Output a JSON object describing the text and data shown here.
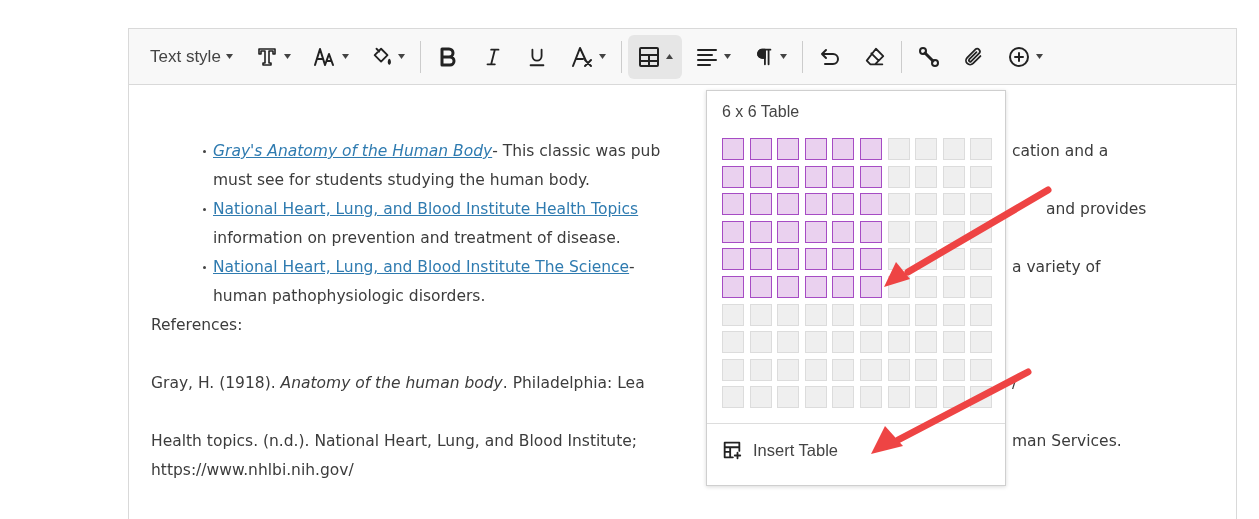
{
  "toolbar": [
    {
      "kind": "label",
      "text": "Text style",
      "caret": true,
      "selected": false
    },
    {
      "kind": "font-icon",
      "caret": true,
      "selected": false
    },
    {
      "kind": "size-icon",
      "caret": true,
      "selected": false
    },
    {
      "kind": "fill-icon",
      "caret": true,
      "selected": false
    },
    {
      "kind": "separator"
    },
    {
      "kind": "bold-icon",
      "caret": false,
      "selected": false
    },
    {
      "kind": "italic-icon",
      "caret": false,
      "selected": false
    },
    {
      "kind": "underline-icon",
      "caret": false,
      "selected": false
    },
    {
      "kind": "clear-format-icon",
      "caret": true,
      "selected": false
    },
    {
      "kind": "separator"
    },
    {
      "kind": "table-icon",
      "caret": true,
      "selected": true
    },
    {
      "kind": "align-icon",
      "caret": true,
      "selected": false
    },
    {
      "kind": "paragraph-icon",
      "caret": true,
      "selected": false
    },
    {
      "kind": "separator"
    },
    {
      "kind": "undo-icon",
      "caret": false,
      "selected": false
    },
    {
      "kind": "eraser-icon",
      "caret": false,
      "selected": false
    },
    {
      "kind": "separator"
    },
    {
      "kind": "link-icon",
      "caret": false,
      "selected": false
    },
    {
      "kind": "attach-icon",
      "caret": false,
      "selected": false
    },
    {
      "kind": "add-icon",
      "caret": true,
      "selected": false
    }
  ],
  "content": [
    {
      "kind": "bullet",
      "segments": [
        {
          "kind": "link",
          "text": "Gray's Anatomy of the Human Body",
          "italic": true
        },
        {
          "kind": "text",
          "text": "- This classic was pub"
        }
      ],
      "right": "cation and a"
    },
    {
      "kind": "continuation",
      "segments": [
        {
          "kind": "text",
          "text": "must see for students studying the human body."
        }
      ]
    },
    {
      "kind": "bullet",
      "segments": [
        {
          "kind": "link",
          "text": "National Heart, Lung, and Blood Institute Health Topics",
          "italic": false
        }
      ],
      "right": "and provides"
    },
    {
      "kind": "continuation",
      "segments": [
        {
          "kind": "text",
          "text": "information on prevention and treatment of disease."
        }
      ]
    },
    {
      "kind": "bullet",
      "segments": [
        {
          "kind": "link",
          "text": "National Heart, Lung, and Blood Institute The Science",
          "italic": false
        },
        {
          "kind": "text",
          "text": " -"
        }
      ],
      "right": "a variety of"
    },
    {
      "kind": "continuation",
      "segments": [
        {
          "kind": "text",
          "text": "human pathophysiologic disorders."
        }
      ]
    },
    {
      "kind": "plain",
      "segments": [
        {
          "kind": "text",
          "text": "References:"
        }
      ]
    },
    {
      "kind": "blank"
    },
    {
      "kind": "plain",
      "segments": [
        {
          "kind": "text",
          "text": "Gray, H. (1918). *Anatomy of the human body*. Philadelphia: Lea"
        }
      ],
      "right": "/"
    },
    {
      "kind": "blank"
    },
    {
      "kind": "plain",
      "segments": [
        {
          "kind": "text",
          "text": "Health topics. (n.d.). National Heart, Lung, and Blood Institute;"
        }
      ],
      "right": "man Services."
    },
    {
      "kind": "plain",
      "segments": [
        {
          "kind": "text",
          "text": "https://www.nhlbi.nih.gov/"
        }
      ]
    }
  ],
  "table_picker": {
    "title": "6 x 6 Table",
    "rows": [
      {
        "cells": [
          {
            "selected": true
          },
          {
            "selected": true
          },
          {
            "selected": true
          },
          {
            "selected": true
          },
          {
            "selected": true
          },
          {
            "selected": true
          },
          {
            "selected": false
          },
          {
            "selected": false
          },
          {
            "selected": false
          },
          {
            "selected": false
          }
        ]
      },
      {
        "cells": [
          {
            "selected": true
          },
          {
            "selected": true
          },
          {
            "selected": true
          },
          {
            "selected": true
          },
          {
            "selected": true
          },
          {
            "selected": true
          },
          {
            "selected": false
          },
          {
            "selected": false
          },
          {
            "selected": false
          },
          {
            "selected": false
          }
        ]
      },
      {
        "cells": [
          {
            "selected": true
          },
          {
            "selected": true
          },
          {
            "selected": true
          },
          {
            "selected": true
          },
          {
            "selected": true
          },
          {
            "selected": true
          },
          {
            "selected": false
          },
          {
            "selected": false
          },
          {
            "selected": false
          },
          {
            "selected": false
          }
        ]
      },
      {
        "cells": [
          {
            "selected": true
          },
          {
            "selected": true
          },
          {
            "selected": true
          },
          {
            "selected": true
          },
          {
            "selected": true
          },
          {
            "selected": true
          },
          {
            "selected": false
          },
          {
            "selected": false
          },
          {
            "selected": false
          },
          {
            "selected": false
          }
        ]
      },
      {
        "cells": [
          {
            "selected": true
          },
          {
            "selected": true
          },
          {
            "selected": true
          },
          {
            "selected": true
          },
          {
            "selected": true
          },
          {
            "selected": true
          },
          {
            "selected": false
          },
          {
            "selected": false
          },
          {
            "selected": false
          },
          {
            "selected": false
          }
        ]
      },
      {
        "cells": [
          {
            "selected": true
          },
          {
            "selected": true
          },
          {
            "selected": true
          },
          {
            "selected": true
          },
          {
            "selected": true
          },
          {
            "selected": true
          },
          {
            "selected": false
          },
          {
            "selected": false
          },
          {
            "selected": false
          },
          {
            "selected": false
          }
        ]
      },
      {
        "cells": [
          {
            "selected": false
          },
          {
            "selected": false
          },
          {
            "selected": false
          },
          {
            "selected": false
          },
          {
            "selected": false
          },
          {
            "selected": false
          },
          {
            "selected": false
          },
          {
            "selected": false
          },
          {
            "selected": false
          },
          {
            "selected": false
          }
        ]
      },
      {
        "cells": [
          {
            "selected": false
          },
          {
            "selected": false
          },
          {
            "selected": false
          },
          {
            "selected": false
          },
          {
            "selected": false
          },
          {
            "selected": false
          },
          {
            "selected": false
          },
          {
            "selected": false
          },
          {
            "selected": false
          },
          {
            "selected": false
          }
        ]
      },
      {
        "cells": [
          {
            "selected": false
          },
          {
            "selected": false
          },
          {
            "selected": false
          },
          {
            "selected": false
          },
          {
            "selected": false
          },
          {
            "selected": false
          },
          {
            "selected": false
          },
          {
            "selected": false
          },
          {
            "selected": false
          },
          {
            "selected": false
          }
        ]
      },
      {
        "cells": [
          {
            "selected": false
          },
          {
            "selected": false
          },
          {
            "selected": false
          },
          {
            "selected": false
          },
          {
            "selected": false
          },
          {
            "selected": false
          },
          {
            "selected": false
          },
          {
            "selected": false
          },
          {
            "selected": false
          },
          {
            "selected": false
          }
        ]
      }
    ],
    "action": "Insert Table"
  }
}
